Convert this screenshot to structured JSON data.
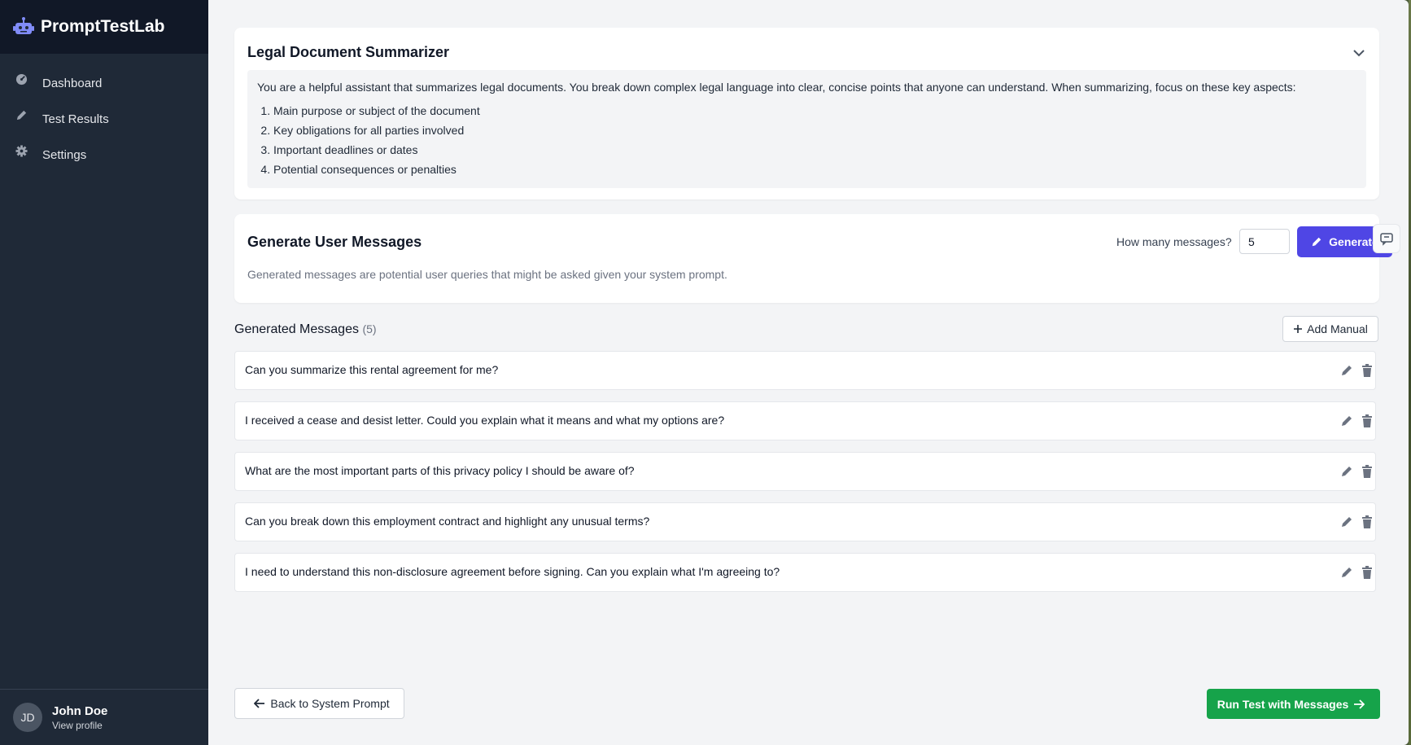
{
  "app": {
    "name": "PromptTestLab"
  },
  "sidebar": {
    "items": [
      {
        "label": "Dashboard",
        "icon": "dashboard-icon"
      },
      {
        "label": "Test Results",
        "icon": "pencil-icon"
      },
      {
        "label": "Settings",
        "icon": "gear-icon"
      }
    ],
    "user": {
      "initials": "JD",
      "name": "John Doe",
      "link": "View profile"
    }
  },
  "prompt": {
    "title": "Legal Document Summarizer",
    "intro": "You are a helpful assistant that summarizes legal documents. You break down complex legal language into clear, concise points that anyone can understand. When summarizing, focus on these key aspects:",
    "points": [
      "Main purpose or subject of the document",
      "Key obligations for all parties involved",
      "Important deadlines or dates",
      "Potential consequences or penalties"
    ]
  },
  "generate": {
    "title": "Generate User Messages",
    "description": "Generated messages are potential user queries that might be asked given your system prompt.",
    "count_label": "How many messages?",
    "count_value": "5",
    "button_label": "Generate"
  },
  "messages": {
    "heading": "Generated Messages",
    "count": "(5)",
    "add_label": "Add Manual",
    "items": [
      "Can you summarize this rental agreement for me?",
      "I received a cease and desist letter. Could you explain what it means and what my options are?",
      "What are the most important parts of this privacy policy I should be aware of?",
      "Can you break down this employment contract and highlight any unusual terms?",
      "I need to understand this non-disclosure agreement before signing. Can you explain what I'm agreeing to?"
    ]
  },
  "footer": {
    "back_label": "Back to System Prompt",
    "run_label": "Run Test with Messages"
  },
  "colors": {
    "sidebar": "#1f2937",
    "brand_bar": "#111827",
    "accent": "#4f46e5",
    "success": "#16a34a"
  }
}
